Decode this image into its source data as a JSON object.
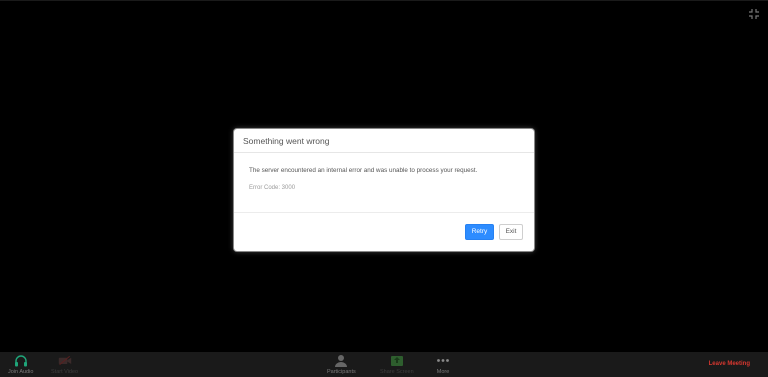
{
  "dialog": {
    "title": "Something went wrong",
    "message": "The server encountered an internal error and was unable to process your request.",
    "error_code": "Error Code: 3000",
    "retry_label": "Retry",
    "exit_label": "Exit"
  },
  "toolbar": {
    "join_audio": "Join Audio",
    "start_video": "Start Video",
    "participants": "Participants",
    "share_screen": "Share Screen",
    "more": "More",
    "leave_meeting": "Leave Meeting"
  },
  "colors": {
    "primary_button": "#2d8cff",
    "leave_meeting": "#d6372f",
    "toolbar_bg": "#1a1a1a",
    "share_screen_icon": "#2e8b2e"
  },
  "icons": {
    "fullscreen": "exit-fullscreen-icon",
    "join_audio": "headphones-icon",
    "start_video": "video-off-icon",
    "participants": "participants-icon",
    "share_screen": "share-screen-icon",
    "more": "more-dots-icon"
  }
}
